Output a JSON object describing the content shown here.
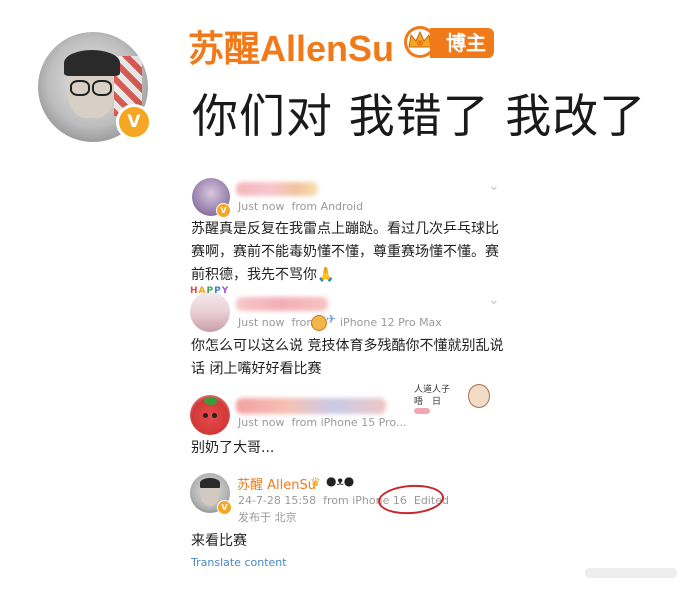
{
  "header": {
    "username": "苏醒AllenSu",
    "verified_badge": "V",
    "role_badge": "博主",
    "crown_icon": "crown-icon",
    "title": "你们对 我错了 我改了",
    "accent_color": "#f07a1a"
  },
  "comments": [
    {
      "time": "Just now",
      "source": "from Android",
      "text_lines": [
        "苏醒真是反复在我雷点上蹦跶。看过几次乒乓球比",
        "赛啊，赛前不能毒奶懂不懂，尊重赛场懂不懂。赛",
        "前积德，我先不骂你🙏"
      ]
    },
    {
      "avatar_label": "HAPPY",
      "time": "Just now",
      "source_prefix": "from",
      "source": "iPhone 12 Pro Max",
      "text_lines": [
        "你怎么可以这么说 竞技体育多残酷你不懂就别乱说",
        "话 闭上嘴好好看比赛"
      ]
    },
    {
      "time": "Just now",
      "source": "from iPhone 15 Pro...",
      "sticker_text": "人道人子\n唔　日",
      "text_lines": [
        "别奶了大哥..."
      ]
    },
    {
      "username": "苏醒 AllenSu",
      "date": "24-7-28 15:58",
      "source": "from iPhone 16",
      "edited": "Edited",
      "location": "发布于 北京",
      "text_lines": [
        "来看比赛"
      ]
    }
  ],
  "translate_label": "Translate content",
  "chevron": "⌄"
}
